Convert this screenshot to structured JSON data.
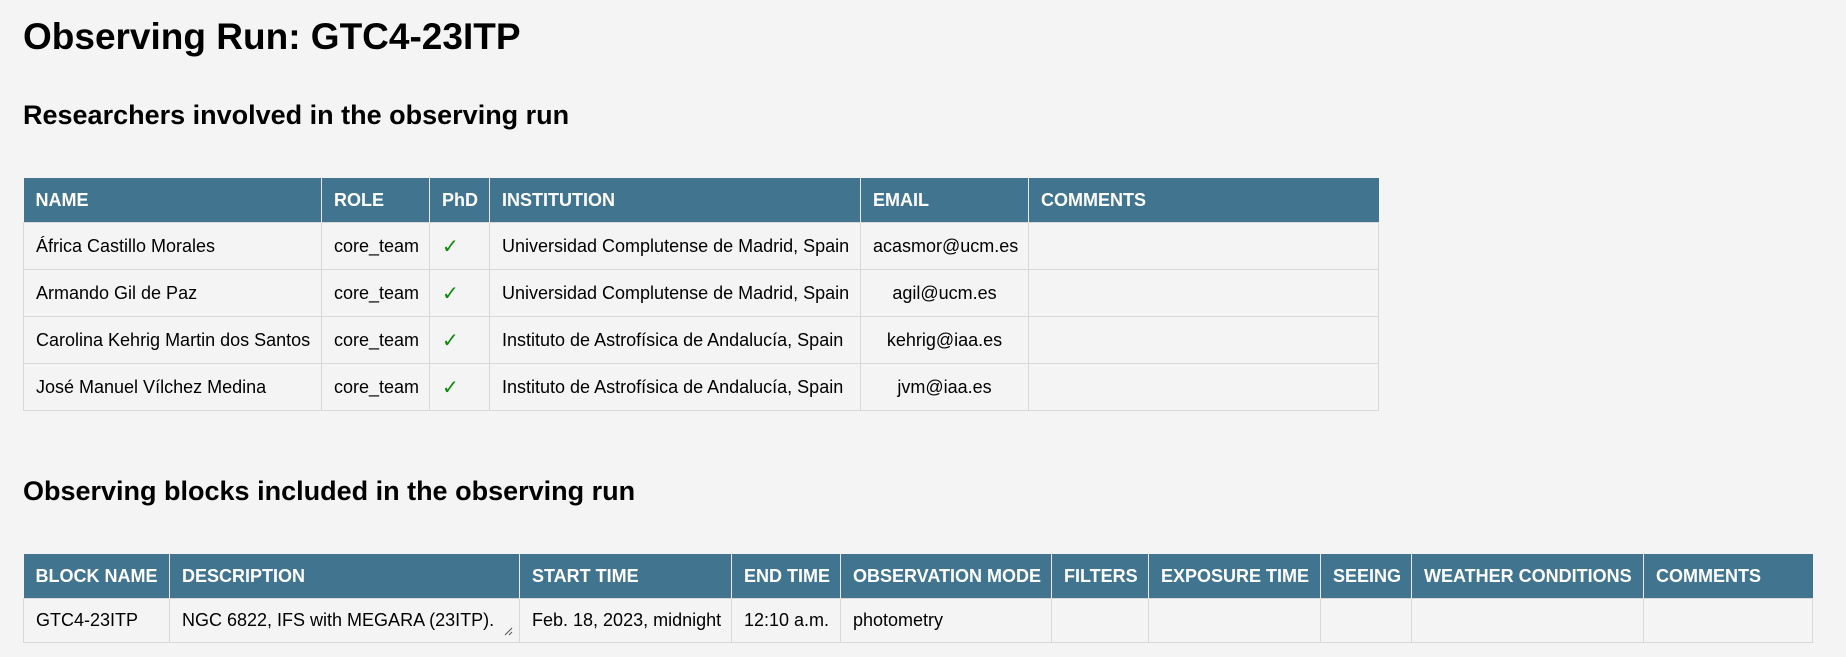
{
  "page": {
    "title": "Observing Run: GTC4-23ITP"
  },
  "researchers": {
    "heading": "Researchers involved in the observing run",
    "columns": [
      "NAME",
      "ROLE",
      "PhD",
      "INSTITUTION",
      "EMAIL",
      "COMMENTS"
    ],
    "rows": [
      {
        "name": "África Castillo Morales",
        "role": "core_team",
        "phd": "✓",
        "institution": "Universidad Complutense de Madrid, Spain",
        "email": "acasmor@ucm.es",
        "comments": ""
      },
      {
        "name": "Armando Gil de Paz",
        "role": "core_team",
        "phd": "✓",
        "institution": "Universidad Complutense de Madrid, Spain",
        "email": "agil@ucm.es",
        "comments": ""
      },
      {
        "name": "Carolina Kehrig Martin dos Santos",
        "role": "core_team",
        "phd": "✓",
        "institution": "Instituto de Astrofísica de Andalucía, Spain",
        "email": "kehrig@iaa.es",
        "comments": ""
      },
      {
        "name": "José Manuel Vílchez Medina",
        "role": "core_team",
        "phd": "✓",
        "institution": "Instituto de Astrofísica de Andalucía, Spain",
        "email": "jvm@iaa.es",
        "comments": ""
      }
    ]
  },
  "blocks": {
    "heading": "Observing blocks included in the observing run",
    "columns": [
      "BLOCK NAME",
      "DESCRIPTION",
      "START TIME",
      "END TIME",
      "OBSERVATION MODE",
      "FILTERS",
      "EXPOSURE TIME",
      "SEEING",
      "WEATHER CONDITIONS",
      "COMMENTS"
    ],
    "rows": [
      {
        "block_name": "GTC4-23ITP",
        "description": "NGC 6822, IFS with MEGARA (23ITP).",
        "start_time": "Feb. 18, 2023, midnight",
        "end_time": "12:10 a.m.",
        "observation_mode": "photometry",
        "filters": "",
        "exposure_time": "",
        "seeing": "",
        "weather_conditions": "",
        "comments": ""
      }
    ]
  },
  "icons": {
    "phd_check": "check-icon",
    "description_resize": "resize-handle-icon"
  },
  "colors": {
    "header_bg": "#41758f",
    "check": "#0a8a0a",
    "page_bg": "#f4f4f4"
  }
}
